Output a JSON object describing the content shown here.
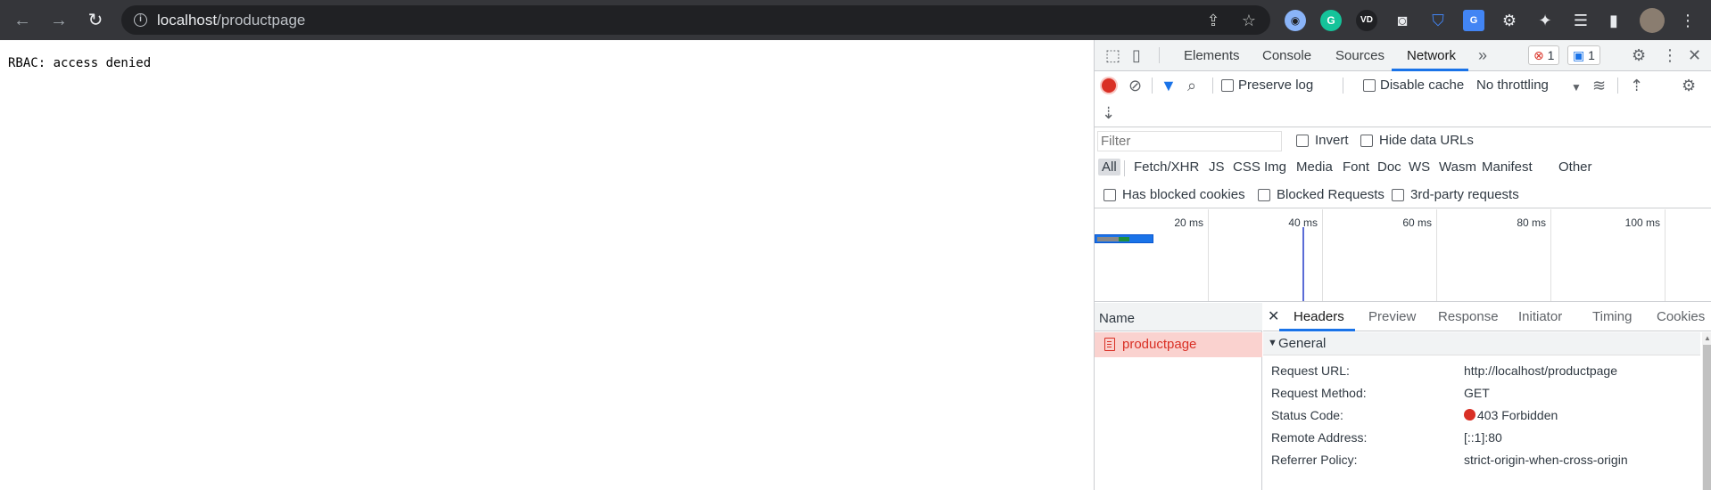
{
  "browser": {
    "url_host": "localhost",
    "url_path": "/productpage"
  },
  "page": {
    "text": "RBAC: access denied"
  },
  "devtools": {
    "tabs": [
      "Elements",
      "Console",
      "Sources",
      "Network"
    ],
    "error_count": "1",
    "message_count": "1",
    "toolbar": {
      "preserve_log": "Preserve log",
      "disable_cache": "Disable cache",
      "throttling": "No throttling"
    },
    "filter": {
      "placeholder": "Filter",
      "invert": "Invert",
      "hide_data_urls": "Hide data URLs"
    },
    "type_filters": [
      "All",
      "Fetch/XHR",
      "JS",
      "CSS",
      "Img",
      "Media",
      "Font",
      "Doc",
      "WS",
      "Wasm",
      "Manifest",
      "Other"
    ],
    "cookie_filters": [
      "Has blocked cookies",
      "Blocked Requests",
      "3rd-party requests"
    ],
    "timeline_ticks": [
      "20 ms",
      "40 ms",
      "60 ms",
      "80 ms",
      "100 ms"
    ],
    "name_column": "Name",
    "requests": [
      {
        "name": "productpage",
        "status_color": "#d93025"
      }
    ],
    "detail_tabs": [
      "Headers",
      "Preview",
      "Response",
      "Initiator",
      "Timing",
      "Cookies"
    ],
    "general": {
      "title": "General",
      "rows": [
        {
          "key": "Request URL:",
          "value": "http://localhost/productpage"
        },
        {
          "key": "Request Method:",
          "value": "GET"
        },
        {
          "key": "Status Code:",
          "value": "403 Forbidden"
        },
        {
          "key": "Remote Address:",
          "value": "[::1]:80"
        },
        {
          "key": "Referrer Policy:",
          "value": "strict-origin-when-cross-origin"
        }
      ]
    }
  }
}
